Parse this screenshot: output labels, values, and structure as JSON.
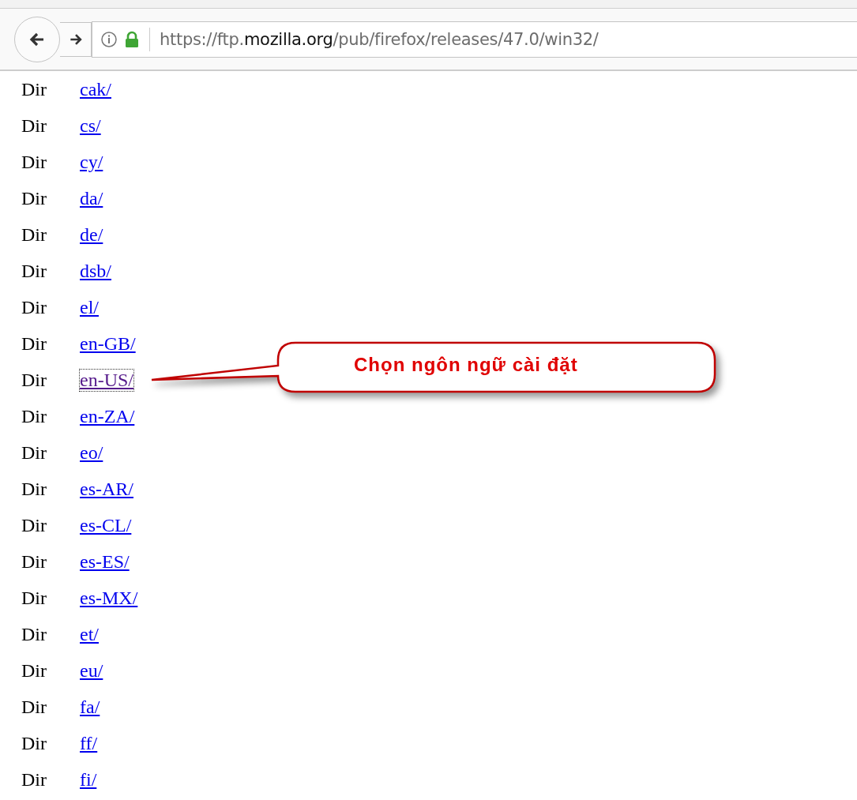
{
  "toolbar": {
    "url": "https://ftp.**mozilla.org**/pub/firefox/releases/47.0/win32/",
    "secure": true
  },
  "listing": [
    {
      "type": "Dir",
      "name": "cak/",
      "focused": false
    },
    {
      "type": "Dir",
      "name": "cs/",
      "focused": false
    },
    {
      "type": "Dir",
      "name": "cy/",
      "focused": false
    },
    {
      "type": "Dir",
      "name": "da/",
      "focused": false
    },
    {
      "type": "Dir",
      "name": "de/",
      "focused": false
    },
    {
      "type": "Dir",
      "name": "dsb/",
      "focused": false
    },
    {
      "type": "Dir",
      "name": "el/",
      "focused": false
    },
    {
      "type": "Dir",
      "name": "en-GB/",
      "focused": false
    },
    {
      "type": "Dir",
      "name": "en-US/",
      "focused": true
    },
    {
      "type": "Dir",
      "name": "en-ZA/",
      "focused": false
    },
    {
      "type": "Dir",
      "name": "eo/",
      "focused": false
    },
    {
      "type": "Dir",
      "name": "es-AR/",
      "focused": false
    },
    {
      "type": "Dir",
      "name": "es-CL/",
      "focused": false
    },
    {
      "type": "Dir",
      "name": "es-ES/",
      "focused": false
    },
    {
      "type": "Dir",
      "name": "es-MX/",
      "focused": false
    },
    {
      "type": "Dir",
      "name": "et/",
      "focused": false
    },
    {
      "type": "Dir",
      "name": "eu/",
      "focused": false
    },
    {
      "type": "Dir",
      "name": "fa/",
      "focused": false
    },
    {
      "type": "Dir",
      "name": "ff/",
      "focused": false
    },
    {
      "type": "Dir",
      "name": "fi/",
      "focused": false
    }
  ],
  "callout": {
    "text": "Chọn ngôn ngữ cài đặt"
  }
}
